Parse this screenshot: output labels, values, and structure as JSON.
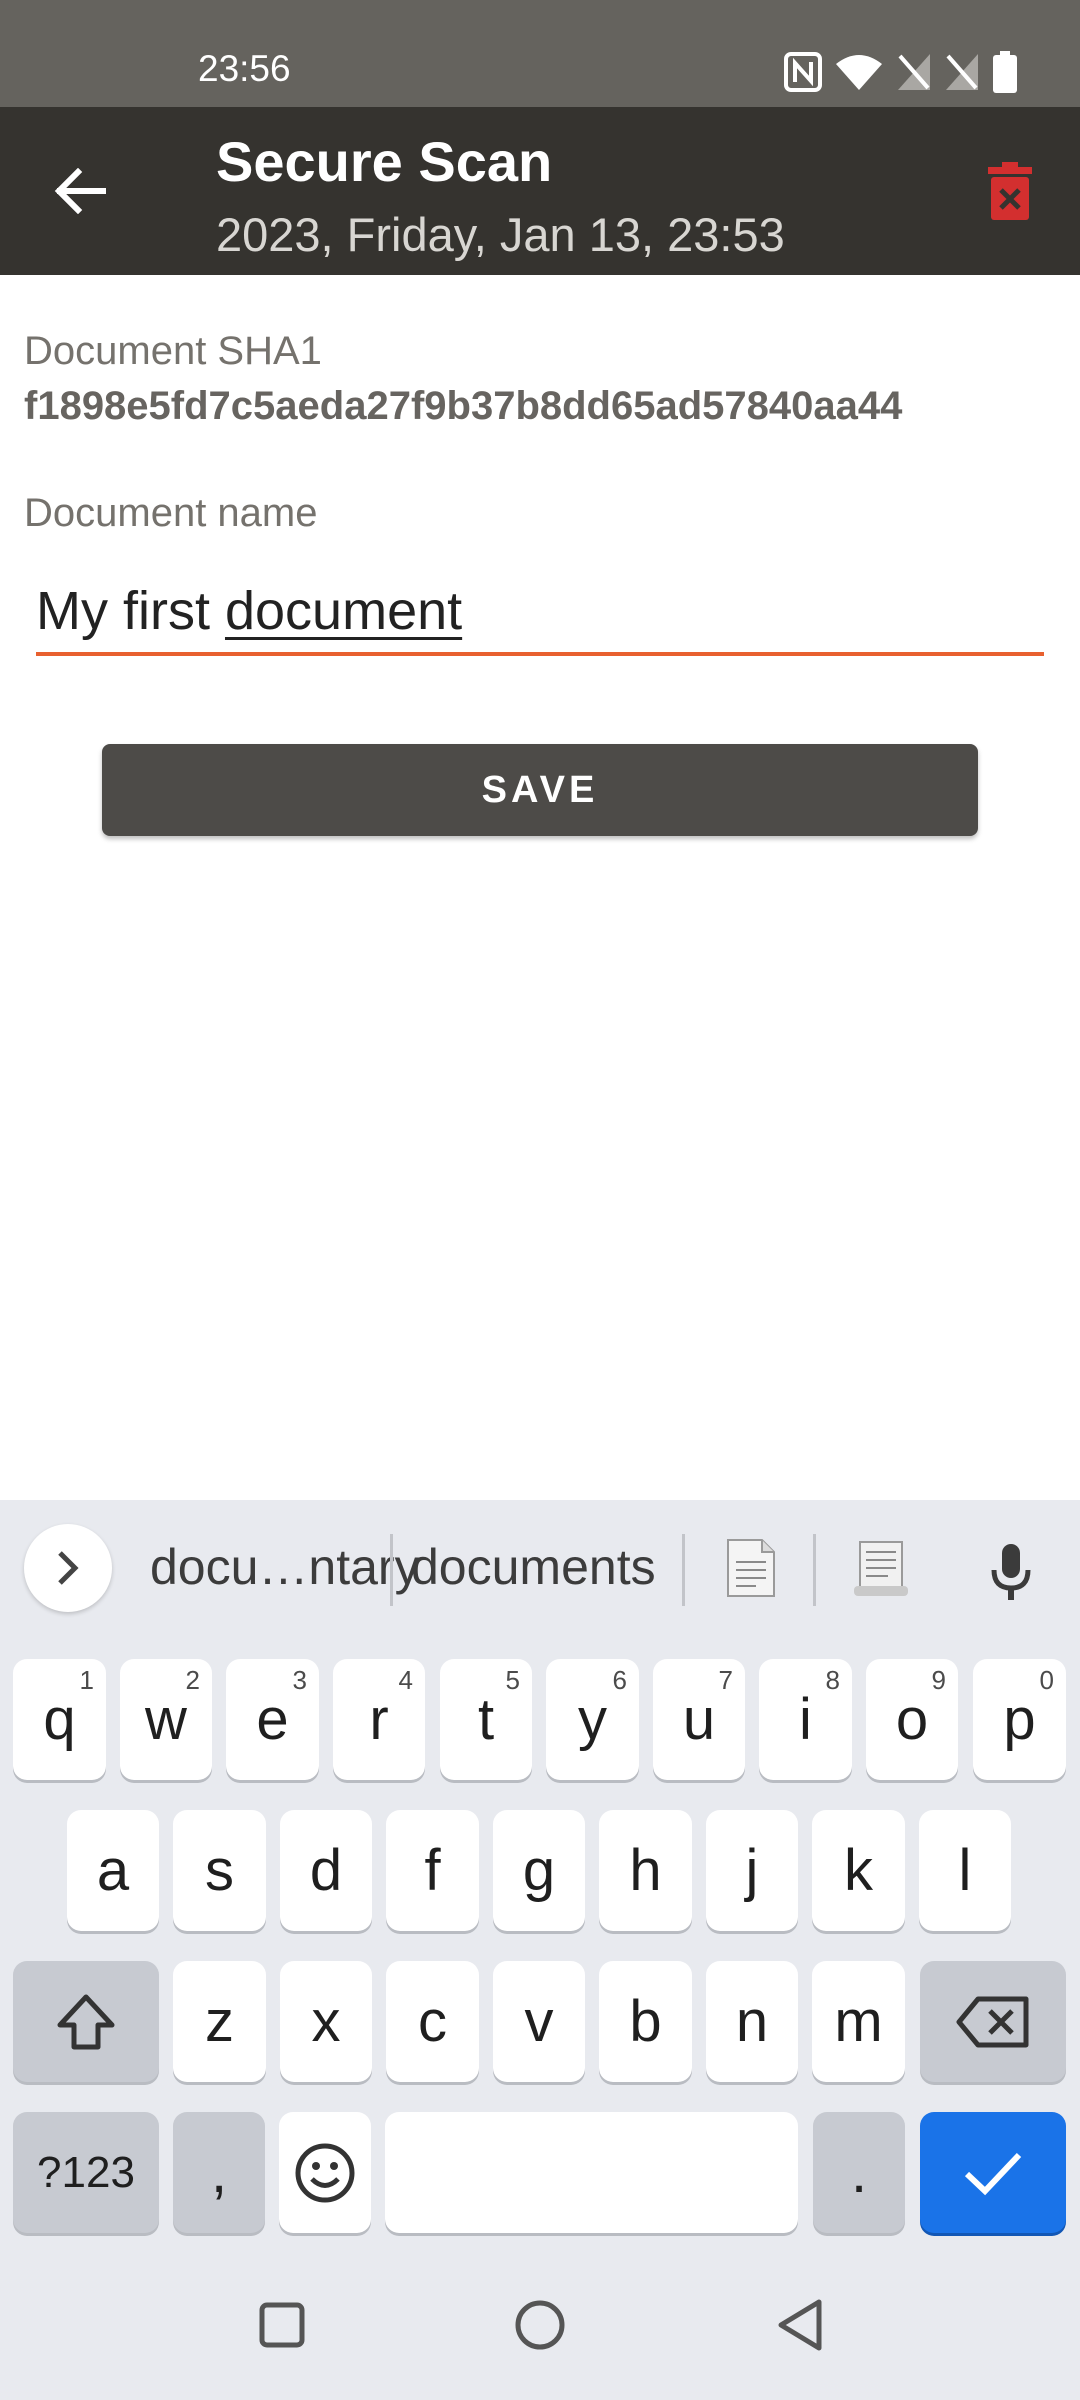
{
  "status_bar": {
    "time": "23:56",
    "icons": [
      "nfc-icon",
      "wifi-icon",
      "no-sim-icon",
      "no-sim-icon",
      "battery-icon"
    ]
  },
  "app_bar": {
    "title": "Secure Scan",
    "subtitle": "2023, Friday, Jan 13, 23:53",
    "back_icon": "arrow-left-icon",
    "delete_icon": "trash-icon",
    "delete_color": "#d32f2f"
  },
  "document": {
    "sha_label": "Document SHA1",
    "sha_value": "f1898e5fd7c5aeda27f9b37b8dd65ad57840aa44",
    "name_label": "Document name",
    "name_value_prefix": "My first ",
    "name_value_composing": "document",
    "accent_color": "#e8602f"
  },
  "save_button": {
    "label": "SAVE"
  },
  "keyboard": {
    "suggestions": [
      "docu…ntary",
      "documents"
    ],
    "suggestion_emojis": [
      "page-icon",
      "receipt-icon"
    ],
    "row1": [
      {
        "k": "q",
        "h": "1"
      },
      {
        "k": "w",
        "h": "2"
      },
      {
        "k": "e",
        "h": "3"
      },
      {
        "k": "r",
        "h": "4"
      },
      {
        "k": "t",
        "h": "5"
      },
      {
        "k": "y",
        "h": "6"
      },
      {
        "k": "u",
        "h": "7"
      },
      {
        "k": "i",
        "h": "8"
      },
      {
        "k": "o",
        "h": "9"
      },
      {
        "k": "p",
        "h": "0"
      }
    ],
    "row2": [
      "a",
      "s",
      "d",
      "f",
      "g",
      "h",
      "j",
      "k",
      "l"
    ],
    "row3": [
      "z",
      "x",
      "c",
      "v",
      "b",
      "n",
      "m"
    ],
    "symbols_key": "?123",
    "comma_key": ",",
    "period_key": ".",
    "action_color": "#1a73e8"
  },
  "nav_bar": {
    "buttons": [
      "recents-icon",
      "home-icon",
      "back-icon"
    ]
  }
}
